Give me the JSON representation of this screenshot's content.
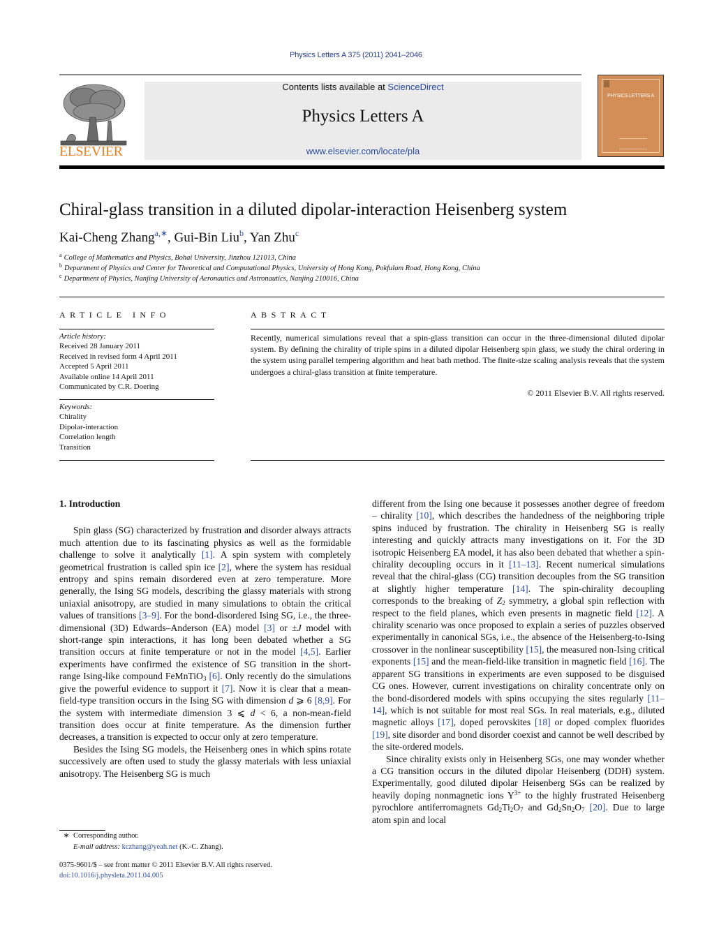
{
  "header": {
    "journal_ref": "Physics Letters A 375 (2011) 2041–2046",
    "contents_prefix": "Contents lists available at ",
    "contents_link": "ScienceDirect",
    "journal_name": "Physics Letters A",
    "journal_url": "www.elsevier.com/locate/pla",
    "publisher_logo_text": "ELSEVIER",
    "cover_title": "PHYSICS LETTERS A",
    "colors": {
      "link": "#2a4aa0",
      "elsevier_orange": "#f07f1f",
      "cover": "#d38e57",
      "banner_bg": "#ebebeb"
    }
  },
  "article": {
    "title": "Chiral-glass transition in a diluted dipolar-interaction Heisenberg system",
    "authors": [
      {
        "name": "Kai-Cheng Zhang",
        "marks": "a,∗",
        "sep": ", "
      },
      {
        "name": "Gui-Bin Liu",
        "marks": "b",
        "sep": ", "
      },
      {
        "name": "Yan Zhu",
        "marks": "c",
        "sep": ""
      }
    ],
    "affiliations": [
      {
        "mark": "a",
        "text": "College of Mathematics and Physics, Bohai University, Jinzhou 121013, China"
      },
      {
        "mark": "b",
        "text": "Department of Physics and Center for Theoretical and Computational Physics, University of Hong Kong, Pokfulam Road, Hong Kong, China"
      },
      {
        "mark": "c",
        "text": "Department of Physics, Nanjing University of Aeronautics and Astronautics, Nanjing 210016, China"
      }
    ]
  },
  "article_info": {
    "heading": "ARTICLE INFO",
    "history_label": "Article history:",
    "history": [
      "Received 28 January 2011",
      "Received in revised form 4 April 2011",
      "Accepted 5 April 2011",
      "Available online 14 April 2011",
      "Communicated by C.R. Doering"
    ],
    "keywords_label": "Keywords:",
    "keywords": [
      "Chirality",
      "Dipolar-interaction",
      "Correlation length",
      "Transition"
    ]
  },
  "abstract": {
    "heading": "ABSTRACT",
    "text": "Recently, numerical simulations reveal that a spin-glass transition can occur in the three-dimensional diluted dipolar system. By defining the chirality of triple spins in a diluted dipolar Heisenberg spin glass, we study the chiral ordering in the system using parallel tempering algorithm and heat bath method. The finite-size scaling analysis reveals that the system undergoes a chiral-glass transition at finite temperature.",
    "copyright": "© 2011 Elsevier B.V. All rights reserved."
  },
  "body": {
    "section_heading": "1. Introduction",
    "paragraphs": [
      [
        {
          "t": "Spin glass (SG) characterized by frustration and disorder always attracts much attention due to its fascinating physics as well as the formidable challenge to solve it analytically "
        },
        {
          "ref": "[1]"
        },
        {
          "t": ". A spin system with completely geometrical frustration is called spin ice "
        },
        {
          "ref": "[2]"
        },
        {
          "t": ", where the system has residual entropy and spins remain disordered even at zero temperature. More generally, the Ising SG models, describing the glassy materials with strong uniaxial anisotropy, are studied in many simulations to obtain the critical values of transitions "
        },
        {
          "ref": "[3–9]"
        },
        {
          "t": ". For the bond-disordered Ising SG, i.e., the three-dimensional (3D) Edwards–Anderson (EA) model "
        },
        {
          "ref": "[3]"
        },
        {
          "t": " or ±"
        },
        {
          "i": "J"
        },
        {
          "t": " model with short-range spin interactions, it has long been debated whether a SG transition occurs at finite temperature or not in the model "
        },
        {
          "ref": "[4,5]"
        },
        {
          "t": ". Earlier experiments have confirmed the existence of SG transition in the short-range Ising-like compound FeMnTiO"
        },
        {
          "sub": "3"
        },
        {
          "t": " "
        },
        {
          "ref": "[6]"
        },
        {
          "t": ". Only recently do the simulations give the powerful evidence to support it "
        },
        {
          "ref": "[7]"
        },
        {
          "t": ". Now it is clear that a mean-field-type transition occurs in the Ising SG with dimension "
        },
        {
          "i": "d"
        },
        {
          "t": " ⩾ 6 "
        },
        {
          "ref": "[8,9]"
        },
        {
          "t": ". For the system with intermediate dimension 3 ⩽ "
        },
        {
          "i": "d"
        },
        {
          "t": " < 6, a non-mean-field transition does occur at finite temperature. As the dimension further decreases, a transition is expected to occur only at zero temperature."
        }
      ],
      [
        {
          "t": "Besides the Ising SG models, the Heisenberg ones in which spins rotate successively are often used to study the glassy materials with less uniaxial anisotropy. The Heisenberg SG is much different from the Ising one because it possesses another degree of freedom – chirality "
        },
        {
          "ref": "[10]"
        },
        {
          "t": ", which describes the handedness of the neighboring triple spins induced by frustration. The chirality in Heisenberg SG is really interesting and quickly attracts many investigations on it. For the 3D isotropic Heisenberg EA model, it has also been debated that whether a spin-chirality decoupling occurs in it "
        },
        {
          "ref": "[11–13]"
        },
        {
          "t": ". Recent numerical simulations reveal that the chiral-glass (CG) transition decouples from the SG transition at slightly higher temperature "
        },
        {
          "ref": "[14]"
        },
        {
          "t": ". The spin-chirality decoupling corresponds to the breaking of "
        },
        {
          "i": "Z"
        },
        {
          "sub": "2"
        },
        {
          "t": " symmetry, a global spin reflection with respect to the field planes, which even presents in magnetic field "
        },
        {
          "ref": "[12]"
        },
        {
          "t": ". A chirality scenario was once proposed to explain a series of puzzles observed experimentally in canonical SGs, i.e., the absence of the Heisenberg-to-Ising crossover in the nonlinear susceptibility "
        },
        {
          "ref": "[15]"
        },
        {
          "t": ", the measured non-Ising critical exponents "
        },
        {
          "ref": "[15]"
        },
        {
          "t": " and the mean-field-like transition in magnetic field "
        },
        {
          "ref": "[16]"
        },
        {
          "t": ". The apparent SG transitions in experiments are even supposed to be disguised CG ones. However, current investigations on chirality concentrate only on the bond-disordered models with spins occupying the sites regularly "
        },
        {
          "ref": "[11–14]"
        },
        {
          "t": ", which is not suitable for most real SGs. In real materials, e.g., diluted magnetic alloys "
        },
        {
          "ref": "[17]"
        },
        {
          "t": ", doped perovskites "
        },
        {
          "ref": "[18]"
        },
        {
          "t": " or doped complex fluorides "
        },
        {
          "ref": "[19]"
        },
        {
          "t": ", site disorder and bond disorder coexist and cannot be well described by the site-ordered models."
        }
      ],
      [
        {
          "t": "Since chirality exists only in Heisenberg SGs, one may wonder whether a CG transition occurs in the diluted dipolar Heisenberg (DDH) system. Experimentally, good diluted dipolar Heisenberg SGs can be realized by heavily doping nonmagnetic ions Y"
        },
        {
          "sup": "3+"
        },
        {
          "t": " to the highly frustrated Heisenberg pyrochlore antiferromagnets Gd"
        },
        {
          "sub": "2"
        },
        {
          "t": "Ti"
        },
        {
          "sub": "2"
        },
        {
          "t": "O"
        },
        {
          "sub": "7"
        },
        {
          "t": " and Gd"
        },
        {
          "sub": "2"
        },
        {
          "t": "Sn"
        },
        {
          "sub": "2"
        },
        {
          "t": "O"
        },
        {
          "sub": "7"
        },
        {
          "t": " "
        },
        {
          "ref": "[20]"
        },
        {
          "t": ". Due to large atom spin and local"
        }
      ]
    ],
    "left_column_end_text": "The Heisenberg SG is much"
  },
  "footnotes": {
    "star": "∗",
    "corresponding": "Corresponding author.",
    "email_label": "E-mail address:",
    "email": "kczhang@yeah.net",
    "email_suffix": " (K.-C. Zhang).",
    "front_matter": "0375-9601/$ – see front matter  © 2011 Elsevier B.V. All rights reserved.",
    "doi": "doi:10.1016/j.physleta.2011.04.005"
  }
}
